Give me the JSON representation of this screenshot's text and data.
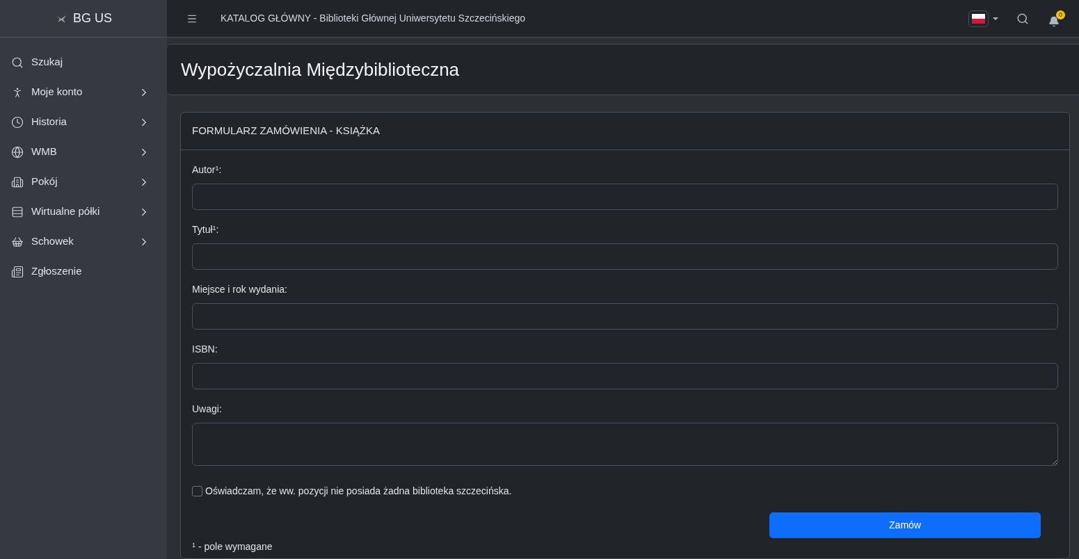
{
  "brand": {
    "name": "BG US"
  },
  "sidebar": {
    "items": [
      {
        "label": "Szukaj",
        "expandable": false
      },
      {
        "label": "Moje konto",
        "expandable": true
      },
      {
        "label": "Historia",
        "expandable": true
      },
      {
        "label": "WMB",
        "expandable": true
      },
      {
        "label": "Pokój",
        "expandable": true
      },
      {
        "label": "Wirtualne półki",
        "expandable": true
      },
      {
        "label": "Schowek",
        "expandable": true
      },
      {
        "label": "Zgłoszenie",
        "expandable": false
      }
    ]
  },
  "topbar": {
    "title": "KATALOG GŁÓWNY - Biblioteki Głównej Uniwersytetu Szczecińskiego",
    "notifications": "0"
  },
  "page": {
    "title": "Wypożyczalnia Międzybiblioteczna"
  },
  "form": {
    "title": "FORMULARZ ZAMÓWIENIA - KSIĄŻKA",
    "fields": [
      {
        "label": "Autor$^{1}$:",
        "kind": "input"
      },
      {
        "label": "Tytuł$^{1}$:",
        "kind": "input"
      },
      {
        "label": "Miejsce i rok wydania:",
        "kind": "input"
      },
      {
        "label": "ISBN:",
        "kind": "input"
      },
      {
        "label": "Uwagi:",
        "kind": "textarea"
      }
    ],
    "declaration": {
      "label": "Oświadczam, że ww. pozycji nie posiada żadna biblioteka szczecińska.",
      "checked": false
    },
    "submit": "Zamów",
    "footnote": "$^{1}$ - pole wymagane"
  }
}
